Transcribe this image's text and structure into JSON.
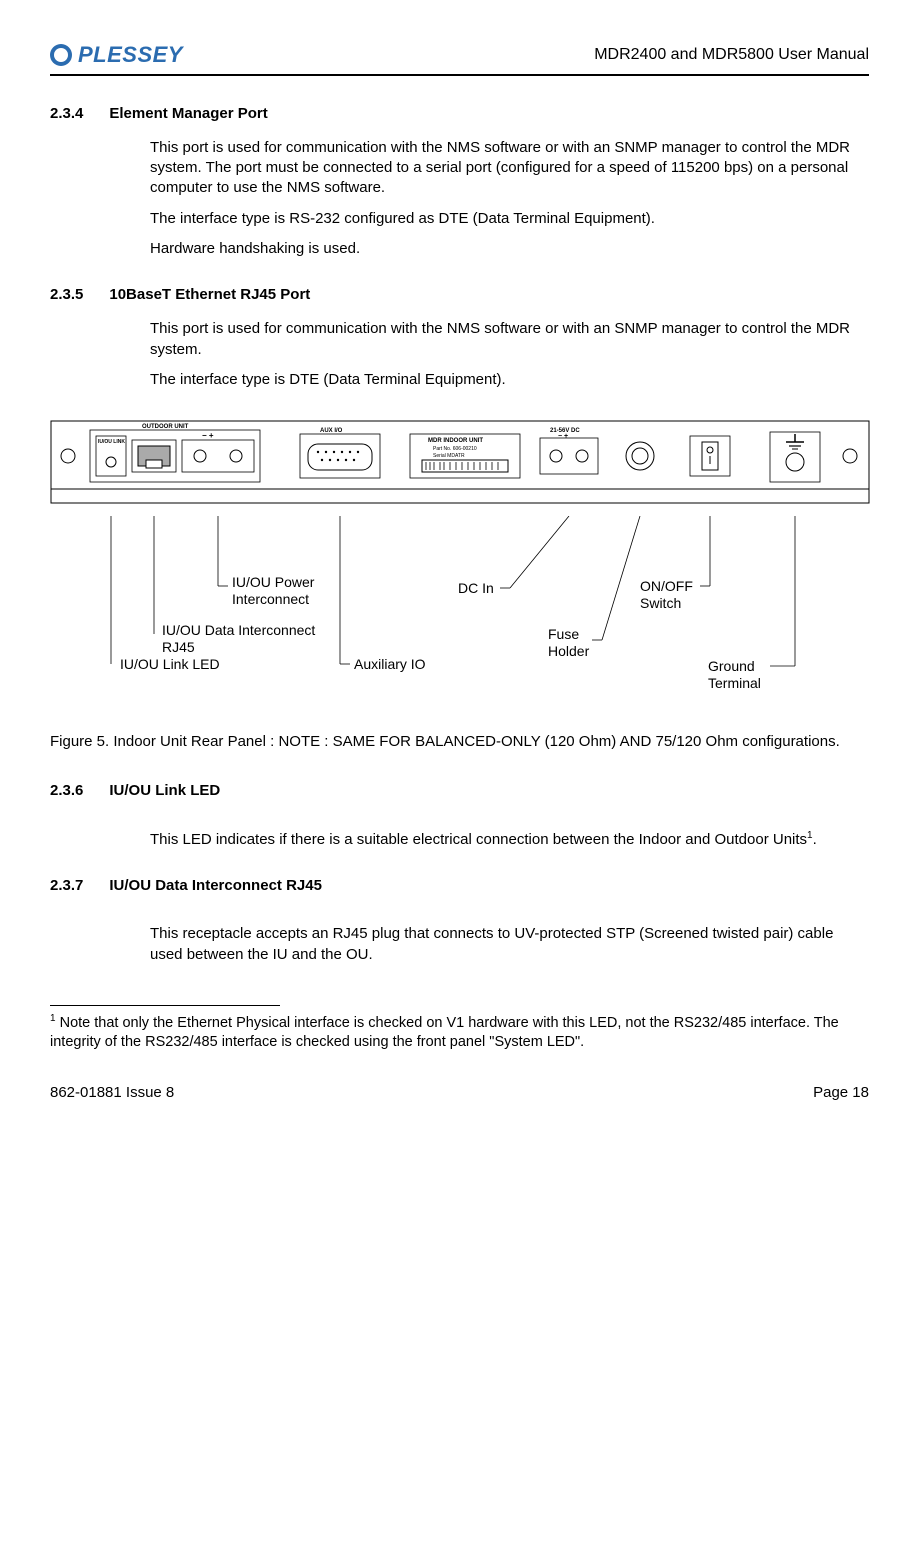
{
  "header": {
    "brand": "PLESSEY",
    "title": "MDR2400 and MDR5800 User Manual"
  },
  "sections": [
    {
      "num": "2.3.4",
      "title": "Element Manager Port",
      "paras": [
        "This port is used for communication with the NMS software or with an SNMP manager to control the MDR system.  The port must be connected to a serial port (configured for a speed of 115200 bps) on a personal computer to use the NMS software.",
        "The interface type is RS-232 configured as DTE (Data Terminal Equipment).",
        "Hardware handshaking is used."
      ]
    },
    {
      "num": "2.3.5",
      "title": "10BaseT Ethernet RJ45 Port",
      "paras": [
        "This port is used for communication with the NMS software or with an SNMP manager to control the MDR system.",
        "The interface type is DTE (Data Terminal Equipment)."
      ]
    }
  ],
  "diagram": {
    "panel_texts": {
      "outdoor_unit": "OUTDOOR UNIT",
      "iu_ou_link": "IU/OU LINK",
      "minus_plus_1": "−  +",
      "aux_io": "AUX I/O",
      "indoor_unit": "MDR INDOOR UNIT",
      "part": "Part No. 606-00210",
      "serial": "Serial MDATR",
      "dc_range": "21-56V DC",
      "minus_plus_2": "−  +"
    },
    "labels": {
      "iu_ou_power": "IU/OU Power Interconnect",
      "iu_ou_data": "IU/OU Data Interconnect RJ45",
      "iu_ou_link_led": "IU/OU Link LED",
      "aux_io": "Auxiliary IO",
      "dc_in": "DC In",
      "fuse_holder": "Fuse Holder",
      "on_off": "ON/OFF Switch",
      "ground": "Ground Terminal"
    }
  },
  "figure_caption": "Figure 5.  Indoor Unit Rear Panel : NOTE : SAME FOR BALANCED-ONLY (120 Ohm) AND 75/120 Ohm configurations.",
  "sections2": [
    {
      "num": "2.3.6",
      "title": "IU/OU Link LED",
      "para_pre": "This LED indicates if there is a suitable electrical connection between the Indoor and Outdoor Units",
      "sup": "1",
      "para_post": "."
    },
    {
      "num": "2.3.7",
      "title": "IU/OU Data Interconnect RJ45",
      "para": "This receptacle accepts an RJ45 plug that connects to UV-protected STP (Screened twisted pair) cable used between the IU and the OU."
    }
  ],
  "footnote": {
    "sup": "1",
    "text": " Note that only the Ethernet Physical interface is checked on V1 hardware with this LED, not the RS232/485 interface.  The integrity of the RS232/485 interface is checked using the front panel \"System LED\"."
  },
  "footer": {
    "left": "862-01881 Issue 8",
    "right": "Page 18"
  }
}
